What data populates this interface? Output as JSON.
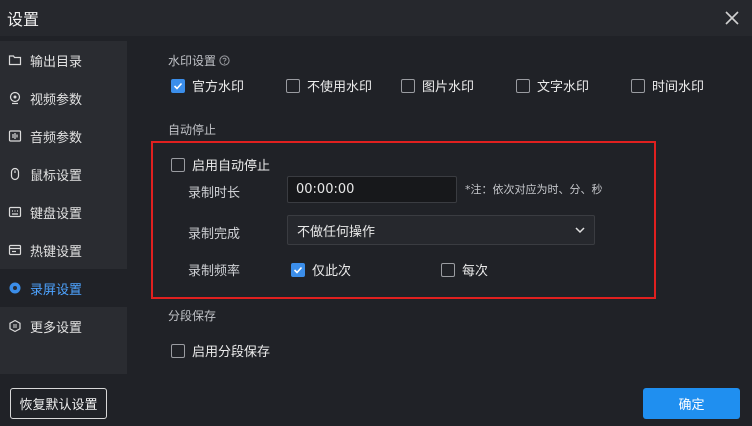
{
  "window": {
    "title": "设置"
  },
  "sidebar": {
    "items": [
      {
        "label": "输出目录",
        "icon": "folder-icon"
      },
      {
        "label": "视频参数",
        "icon": "video-settings-icon"
      },
      {
        "label": "音频参数",
        "icon": "audio-icon"
      },
      {
        "label": "鼠标设置",
        "icon": "mouse-icon"
      },
      {
        "label": "键盘设置",
        "icon": "keyboard-icon"
      },
      {
        "label": "热键设置",
        "icon": "hotkey-icon"
      },
      {
        "label": "录屏设置",
        "icon": "record-icon",
        "active": true
      },
      {
        "label": "更多设置",
        "icon": "more-settings-icon"
      }
    ]
  },
  "watermark": {
    "label": "水印设置",
    "options": [
      {
        "label": "官方水印",
        "checked": true
      },
      {
        "label": "不使用水印",
        "checked": false
      },
      {
        "label": "图片水印",
        "checked": false
      },
      {
        "label": "文字水印",
        "checked": false
      },
      {
        "label": "时间水印",
        "checked": false
      }
    ]
  },
  "auto_stop": {
    "label": "自动停止",
    "enable_label": "启用自动停止",
    "enabled": false,
    "duration_label": "录制时长",
    "duration_value": "00:00:00",
    "duration_note": "*注：依次对应为时、分、秒",
    "complete_label": "录制完成",
    "complete_value": "不做任何操作",
    "frequency_label": "录制频率",
    "frequency_options": [
      {
        "label": "仅此次",
        "checked": true
      },
      {
        "label": "每次",
        "checked": false
      }
    ]
  },
  "segment": {
    "label": "分段保存",
    "enable_label": "启用分段保存",
    "enabled": false
  },
  "footer": {
    "restore_label": "恢复默认设置",
    "ok_label": "确定"
  },
  "colors": {
    "accent": "#1f8ff0",
    "highlight_border": "#e0201f",
    "active_nav_text": "#4da3ff"
  }
}
